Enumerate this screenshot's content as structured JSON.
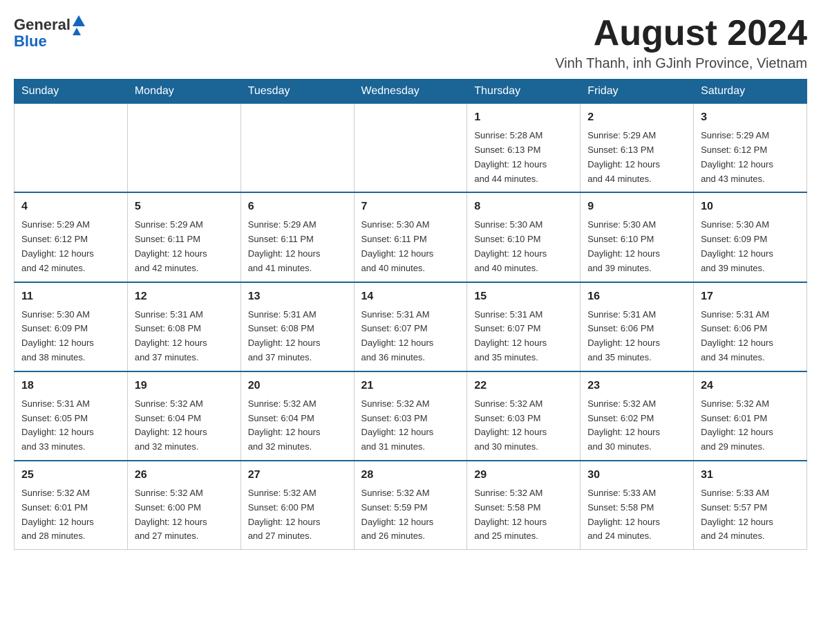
{
  "header": {
    "logo_general": "General",
    "logo_blue": "Blue",
    "month_title": "August 2024",
    "location": "Vinh Thanh, inh GJinh Province, Vietnam"
  },
  "days_of_week": [
    "Sunday",
    "Monday",
    "Tuesday",
    "Wednesday",
    "Thursday",
    "Friday",
    "Saturday"
  ],
  "weeks": [
    {
      "days": [
        {
          "number": "",
          "info": ""
        },
        {
          "number": "",
          "info": ""
        },
        {
          "number": "",
          "info": ""
        },
        {
          "number": "",
          "info": ""
        },
        {
          "number": "1",
          "info": "Sunrise: 5:28 AM\nSunset: 6:13 PM\nDaylight: 12 hours\nand 44 minutes."
        },
        {
          "number": "2",
          "info": "Sunrise: 5:29 AM\nSunset: 6:13 PM\nDaylight: 12 hours\nand 44 minutes."
        },
        {
          "number": "3",
          "info": "Sunrise: 5:29 AM\nSunset: 6:12 PM\nDaylight: 12 hours\nand 43 minutes."
        }
      ]
    },
    {
      "days": [
        {
          "number": "4",
          "info": "Sunrise: 5:29 AM\nSunset: 6:12 PM\nDaylight: 12 hours\nand 42 minutes."
        },
        {
          "number": "5",
          "info": "Sunrise: 5:29 AM\nSunset: 6:11 PM\nDaylight: 12 hours\nand 42 minutes."
        },
        {
          "number": "6",
          "info": "Sunrise: 5:29 AM\nSunset: 6:11 PM\nDaylight: 12 hours\nand 41 minutes."
        },
        {
          "number": "7",
          "info": "Sunrise: 5:30 AM\nSunset: 6:11 PM\nDaylight: 12 hours\nand 40 minutes."
        },
        {
          "number": "8",
          "info": "Sunrise: 5:30 AM\nSunset: 6:10 PM\nDaylight: 12 hours\nand 40 minutes."
        },
        {
          "number": "9",
          "info": "Sunrise: 5:30 AM\nSunset: 6:10 PM\nDaylight: 12 hours\nand 39 minutes."
        },
        {
          "number": "10",
          "info": "Sunrise: 5:30 AM\nSunset: 6:09 PM\nDaylight: 12 hours\nand 39 minutes."
        }
      ]
    },
    {
      "days": [
        {
          "number": "11",
          "info": "Sunrise: 5:30 AM\nSunset: 6:09 PM\nDaylight: 12 hours\nand 38 minutes."
        },
        {
          "number": "12",
          "info": "Sunrise: 5:31 AM\nSunset: 6:08 PM\nDaylight: 12 hours\nand 37 minutes."
        },
        {
          "number": "13",
          "info": "Sunrise: 5:31 AM\nSunset: 6:08 PM\nDaylight: 12 hours\nand 37 minutes."
        },
        {
          "number": "14",
          "info": "Sunrise: 5:31 AM\nSunset: 6:07 PM\nDaylight: 12 hours\nand 36 minutes."
        },
        {
          "number": "15",
          "info": "Sunrise: 5:31 AM\nSunset: 6:07 PM\nDaylight: 12 hours\nand 35 minutes."
        },
        {
          "number": "16",
          "info": "Sunrise: 5:31 AM\nSunset: 6:06 PM\nDaylight: 12 hours\nand 35 minutes."
        },
        {
          "number": "17",
          "info": "Sunrise: 5:31 AM\nSunset: 6:06 PM\nDaylight: 12 hours\nand 34 minutes."
        }
      ]
    },
    {
      "days": [
        {
          "number": "18",
          "info": "Sunrise: 5:31 AM\nSunset: 6:05 PM\nDaylight: 12 hours\nand 33 minutes."
        },
        {
          "number": "19",
          "info": "Sunrise: 5:32 AM\nSunset: 6:04 PM\nDaylight: 12 hours\nand 32 minutes."
        },
        {
          "number": "20",
          "info": "Sunrise: 5:32 AM\nSunset: 6:04 PM\nDaylight: 12 hours\nand 32 minutes."
        },
        {
          "number": "21",
          "info": "Sunrise: 5:32 AM\nSunset: 6:03 PM\nDaylight: 12 hours\nand 31 minutes."
        },
        {
          "number": "22",
          "info": "Sunrise: 5:32 AM\nSunset: 6:03 PM\nDaylight: 12 hours\nand 30 minutes."
        },
        {
          "number": "23",
          "info": "Sunrise: 5:32 AM\nSunset: 6:02 PM\nDaylight: 12 hours\nand 30 minutes."
        },
        {
          "number": "24",
          "info": "Sunrise: 5:32 AM\nSunset: 6:01 PM\nDaylight: 12 hours\nand 29 minutes."
        }
      ]
    },
    {
      "days": [
        {
          "number": "25",
          "info": "Sunrise: 5:32 AM\nSunset: 6:01 PM\nDaylight: 12 hours\nand 28 minutes."
        },
        {
          "number": "26",
          "info": "Sunrise: 5:32 AM\nSunset: 6:00 PM\nDaylight: 12 hours\nand 27 minutes."
        },
        {
          "number": "27",
          "info": "Sunrise: 5:32 AM\nSunset: 6:00 PM\nDaylight: 12 hours\nand 27 minutes."
        },
        {
          "number": "28",
          "info": "Sunrise: 5:32 AM\nSunset: 5:59 PM\nDaylight: 12 hours\nand 26 minutes."
        },
        {
          "number": "29",
          "info": "Sunrise: 5:32 AM\nSunset: 5:58 PM\nDaylight: 12 hours\nand 25 minutes."
        },
        {
          "number": "30",
          "info": "Sunrise: 5:33 AM\nSunset: 5:58 PM\nDaylight: 12 hours\nand 24 minutes."
        },
        {
          "number": "31",
          "info": "Sunrise: 5:33 AM\nSunset: 5:57 PM\nDaylight: 12 hours\nand 24 minutes."
        }
      ]
    }
  ]
}
